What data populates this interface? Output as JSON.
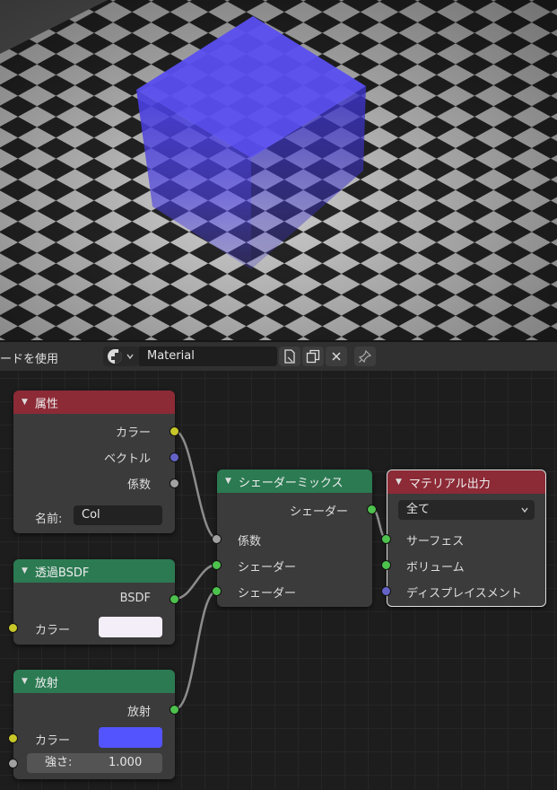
{
  "header": {
    "use_nodes_label": "ードを使用",
    "material_name": "Material"
  },
  "nodes": {
    "attribute": {
      "title": "属性",
      "outputs": [
        "カラー",
        "ベクトル",
        "係数"
      ],
      "name_label": "名前:",
      "name_value": "Col"
    },
    "transparent": {
      "title": "透過BSDF",
      "output": "BSDF",
      "color_label": "カラー",
      "color": "#f3eef8"
    },
    "emission": {
      "title": "放射",
      "output": "放射",
      "color_label": "カラー",
      "color": "#5454ff",
      "strength_label": "強さ:",
      "strength_value": "1.000"
    },
    "mix": {
      "title": "シェーダーミックス",
      "output": "シェーダー",
      "inputs": [
        "係数",
        "シェーダー",
        "シェーダー"
      ]
    },
    "output": {
      "title": "マテリアル出力",
      "target": "全て",
      "inputs": [
        "サーフェス",
        "ボリューム",
        "ディスプレイスメント"
      ]
    }
  },
  "colors": {
    "header_red": "#8c2a36",
    "header_green": "#2b7a52",
    "cube_blue": "#4a3fe0"
  },
  "icons": [
    "sphere-shading-icon",
    "chevron-down-icon",
    "new-material-icon",
    "duplicate-icon",
    "close-icon",
    "pin-icon"
  ]
}
